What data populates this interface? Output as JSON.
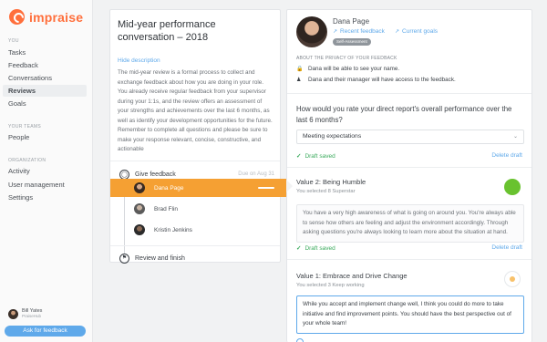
{
  "app": {
    "name": "impraise"
  },
  "sidebar": {
    "you_label": "YOU",
    "items": [
      {
        "label": "Tasks"
      },
      {
        "label": "Feedback"
      },
      {
        "label": "Conversations"
      },
      {
        "label": "Reviews",
        "active": true
      },
      {
        "label": "Goals"
      }
    ],
    "teams_label": "YOUR TEAMS",
    "team_items": [
      {
        "label": "People"
      }
    ],
    "org_label": "ORGANIZATION",
    "org_items": [
      {
        "label": "Activity"
      },
      {
        "label": "User management"
      },
      {
        "label": "Settings"
      }
    ],
    "user": {
      "name": "Bill Yates",
      "org": "PraiseHub"
    },
    "ask_button": "Ask for feedback"
  },
  "conversation": {
    "title": "Mid-year performance conversation – 2018",
    "hide_description": "Hide description",
    "description": "The mid-year review is a formal process to collect and exchange feedback about how you are doing in your role. You already receive regular feedback from your supervisor during your 1:1s, and the review offers an assessment of your strengths and achievements over the last 6 months, as well as identify your development opportunities for the future. Remember to complete all questions and please be sure to make your response relevant, concise, constructive, and actionable",
    "give_feedback": "Give feedback",
    "due": "Due on Aug 31",
    "reviewees": [
      {
        "name": "Dana Page",
        "active": true
      },
      {
        "name": "Brad Flin"
      },
      {
        "name": "Kristin Jenkins"
      }
    ],
    "review_finish": "Review and finish"
  },
  "detail": {
    "name": "Dana Page",
    "recent_feedback": "Recent feedback",
    "current_goals": "Current goals",
    "badge": "Self-Assessment",
    "privacy_heading": "ABOUT THE PRIVACY OF YOUR FEEDBACK",
    "privacy_1": "Dana will be able to see your name.",
    "privacy_2": "Dana and their manager will have access to the feedback.",
    "question": "How would you rate your direct report's overall performance over the last 6 months?",
    "select_value": "Meeting expectations",
    "draft_saved": "Draft saved",
    "delete_draft": "Delete draft",
    "value2": {
      "title": "Value 2: Being Humble",
      "selected": "You selected 8   Superstar",
      "text": "You have a very high awareness of what is going on around you. You're always able to sense how others are feeling and adjust the environment accordingly. Through asking questions you're always looking to learn more about the situation at hand."
    },
    "value1": {
      "title": "Value 1: Embrace and Drive Change",
      "selected": "You selected 3   Keep working",
      "text": "While you accept and implement change well, I think you could do more to take initiative and find improvement points. You should have the best perspective out of your whole team!"
    }
  },
  "colors": {
    "accent": "#ff6f3c",
    "link": "#5fa9ea",
    "active_row": "#f5a033",
    "saved": "#3aaa5c",
    "superstar": "#69c22f",
    "keep_working": "#f8c16a"
  }
}
